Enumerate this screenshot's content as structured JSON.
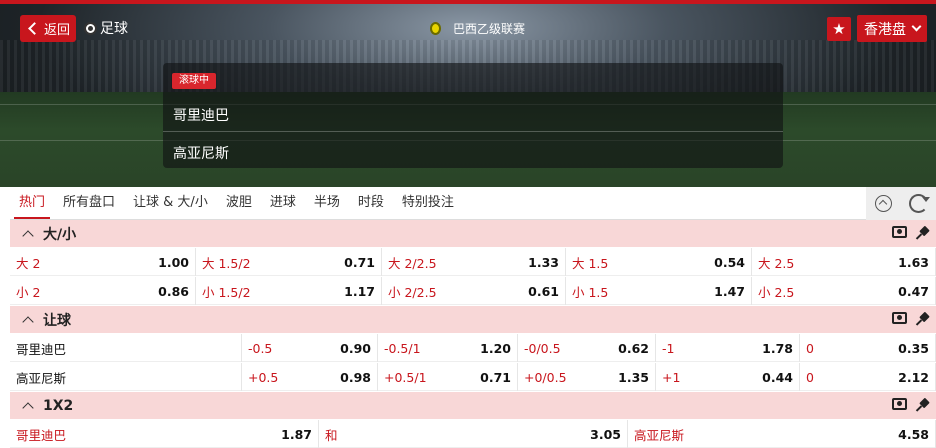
{
  "header": {
    "back_label": "返回",
    "sport_label": "足球",
    "league_label": "巴西乙级联赛",
    "fav_icon": "★",
    "odds_format": "香港盘"
  },
  "match": {
    "status_badge": "滚球中",
    "home_team": "哥里迪巴",
    "away_team": "高亚尼斯"
  },
  "tabs": [
    "热门",
    "所有盘口",
    "让球 & 大/小",
    "波胆",
    "进球",
    "半场",
    "时段",
    "特别投注"
  ],
  "active_tab": 0,
  "colors": {
    "accent": "#c8161d",
    "market_header_bg": "#f8d7d7"
  },
  "markets": {
    "over_under": {
      "title": "大/小",
      "over": [
        {
          "label": "大 2",
          "odds": "1.00"
        },
        {
          "label": "大 1.5/2",
          "odds": "0.71"
        },
        {
          "label": "大 2/2.5",
          "odds": "1.33"
        },
        {
          "label": "大 1.5",
          "odds": "0.54"
        },
        {
          "label": "大 2.5",
          "odds": "1.63"
        }
      ],
      "under": [
        {
          "label": "小 2",
          "odds": "0.86"
        },
        {
          "label": "小 1.5/2",
          "odds": "1.17"
        },
        {
          "label": "小 2/2.5",
          "odds": "0.61"
        },
        {
          "label": "小 1.5",
          "odds": "1.47"
        },
        {
          "label": "小 2.5",
          "odds": "0.47"
        }
      ]
    },
    "handicap": {
      "title": "让球",
      "home_team": "哥里迪巴",
      "away_team": "高亚尼斯",
      "home": [
        {
          "label": "-0.5",
          "odds": "0.90"
        },
        {
          "label": "-0.5/1",
          "odds": "1.20"
        },
        {
          "label": "-0/0.5",
          "odds": "0.62"
        },
        {
          "label": "-1",
          "odds": "1.78"
        },
        {
          "label": "0",
          "odds": "0.35"
        }
      ],
      "away": [
        {
          "label": "+0.5",
          "odds": "0.98"
        },
        {
          "label": "+0.5/1",
          "odds": "0.71"
        },
        {
          "label": "+0/0.5",
          "odds": "1.35"
        },
        {
          "label": "+1",
          "odds": "0.44"
        },
        {
          "label": "0",
          "odds": "2.12"
        }
      ]
    },
    "one_x_two": {
      "title": "1X2",
      "items": [
        {
          "label": "哥里迪巴",
          "odds": "1.87"
        },
        {
          "label": "和",
          "odds": "3.05"
        },
        {
          "label": "高亚尼斯",
          "odds": "4.58"
        }
      ]
    }
  }
}
